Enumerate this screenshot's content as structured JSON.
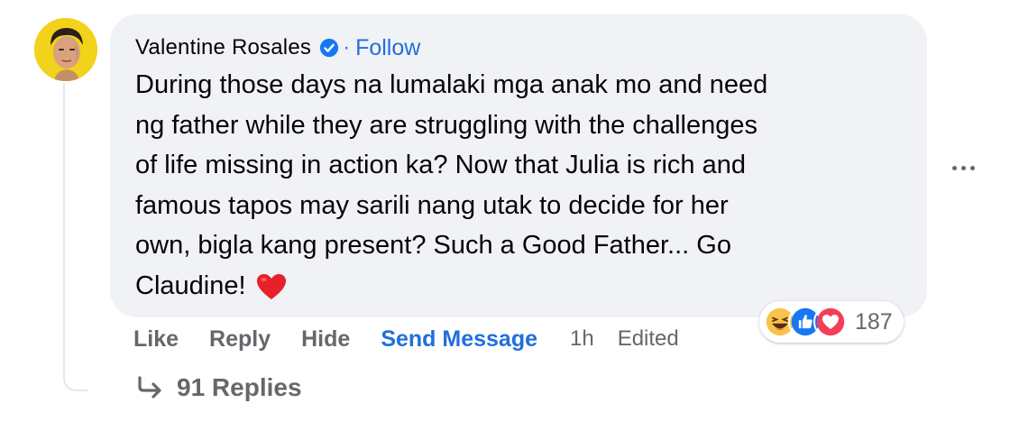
{
  "comment": {
    "author": "Valentine Rosales",
    "verified_icon": "verified-badge-icon",
    "separator": "·",
    "follow_label": "Follow",
    "text": "During those days na lumalaki mga anak mo and need\nng father while they are struggling with the challenges\nof life missing in action ka? Now that Julia is rich and\nfamous tapos may sarili nang utak to decide for her\nown, bigla kang present? Such a Good Father... Go\nClaudine!",
    "trailing_emoji": "red-heart-icon"
  },
  "actions": {
    "like": "Like",
    "reply": "Reply",
    "hide": "Hide",
    "send_message": "Send Message",
    "time": "1h",
    "edited": "Edited"
  },
  "reactions": {
    "icons": [
      "haha-icon",
      "like-icon",
      "love-icon"
    ],
    "count": "187"
  },
  "replies": {
    "label": "91 Replies"
  },
  "colors": {
    "bubble": "#f0f2f5",
    "link": "#216fdb",
    "muted": "#65676b",
    "avatar_bg": "#f2d21a"
  }
}
